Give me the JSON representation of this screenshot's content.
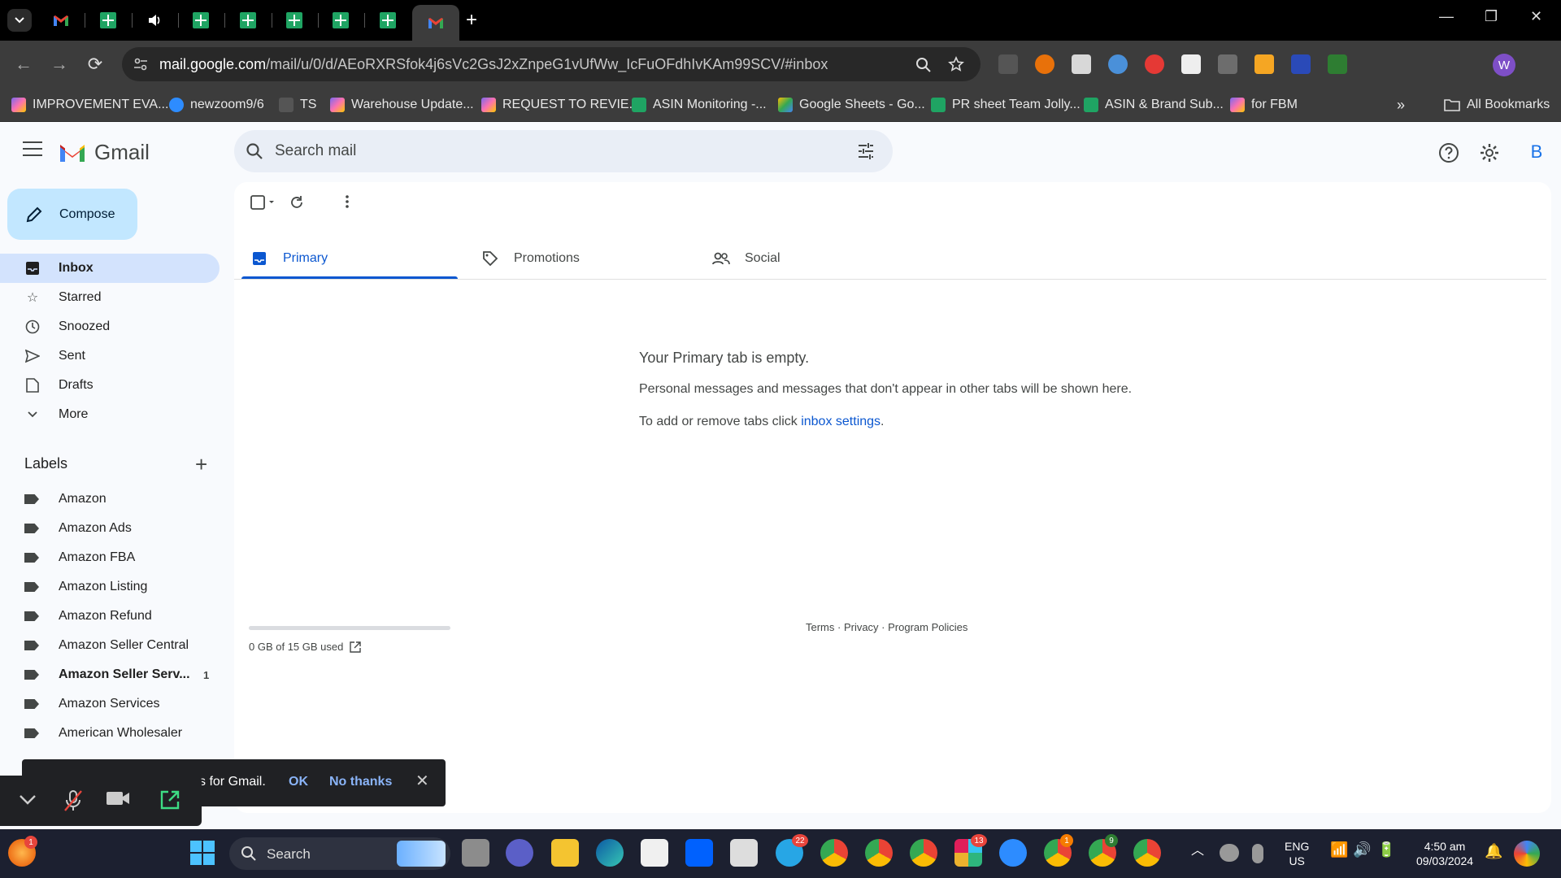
{
  "browser": {
    "url_host": "mail.google.com",
    "url_path": "/mail/u/0/d/AEoRXRSfok4j6sVc2GsJ2xZnpeG1vUfWw_IcFuOFdhIvKAm99SCV/#inbox",
    "profile_initial": "W",
    "bookmarks": [
      {
        "label": "IMPROVEMENT EVA...",
        "icon": "clickup-icon"
      },
      {
        "label": "newzoom9/6",
        "icon": "zoom-icon"
      },
      {
        "label": "TS",
        "icon": "chart-icon"
      },
      {
        "label": "Warehouse Update...",
        "icon": "clickup-icon"
      },
      {
        "label": "REQUEST TO REVIE...",
        "icon": "clickup-icon"
      },
      {
        "label": "ASIN Monitoring -...",
        "icon": "sheets-icon"
      },
      {
        "label": "Google Sheets - Go...",
        "icon": "drive-icon"
      },
      {
        "label": "PR sheet Team Jolly...",
        "icon": "sheets-icon"
      },
      {
        "label": "ASIN & Brand Sub...",
        "icon": "sheets-icon"
      },
      {
        "label": "for FBM",
        "icon": "clickup-icon"
      }
    ],
    "all_bookmarks": "All Bookmarks"
  },
  "gmail": {
    "app_name": "Gmail",
    "search_placeholder": "Search mail",
    "account_initial": "B",
    "compose": "Compose",
    "nav": [
      {
        "label": "Inbox",
        "icon": "inbox-icon"
      },
      {
        "label": "Starred",
        "icon": "star-icon"
      },
      {
        "label": "Snoozed",
        "icon": "clock-icon"
      },
      {
        "label": "Sent",
        "icon": "send-icon"
      },
      {
        "label": "Drafts",
        "icon": "draft-icon"
      },
      {
        "label": "More",
        "icon": "chevron-down-icon"
      }
    ],
    "labels_title": "Labels",
    "labels": [
      {
        "label": "Amazon",
        "count": ""
      },
      {
        "label": "Amazon Ads",
        "count": ""
      },
      {
        "label": "Amazon FBA",
        "count": ""
      },
      {
        "label": "Amazon Listing",
        "count": ""
      },
      {
        "label": "Amazon Refund",
        "count": ""
      },
      {
        "label": "Amazon Seller Central",
        "count": ""
      },
      {
        "label": "Amazon Seller Serv...",
        "count": "1"
      },
      {
        "label": "Amazon Services",
        "count": ""
      },
      {
        "label": "American Wholesaler",
        "count": ""
      }
    ],
    "tabs": [
      {
        "label": "Primary",
        "icon": "inbox-tab-icon"
      },
      {
        "label": "Promotions",
        "icon": "tag-icon"
      },
      {
        "label": "Social",
        "icon": "people-icon"
      }
    ],
    "empty": {
      "title": "Your Primary tab is empty.",
      "desc": "Personal messages and messages that don't appear in other tabs will be shown here.",
      "hint_prefix": "To add or remove tabs click ",
      "hint_link": "inbox settings",
      "hint_suffix": "."
    },
    "storage": {
      "text": "0 GB of 15 GB used",
      "used_fraction": 0
    },
    "footer": "Terms · Privacy · Program Policies",
    "promo": {
      "text": "s for Gmail.",
      "ok": "OK",
      "no": "No thanks"
    }
  },
  "taskbar": {
    "search": "Search",
    "lang1": "ENG",
    "lang2": "US",
    "time": "4:50 am",
    "date": "09/03/2024",
    "badges": {
      "edge_like": "1",
      "telegram": "22",
      "slack": "13",
      "chrome1": "1",
      "chrome2": "9"
    }
  }
}
